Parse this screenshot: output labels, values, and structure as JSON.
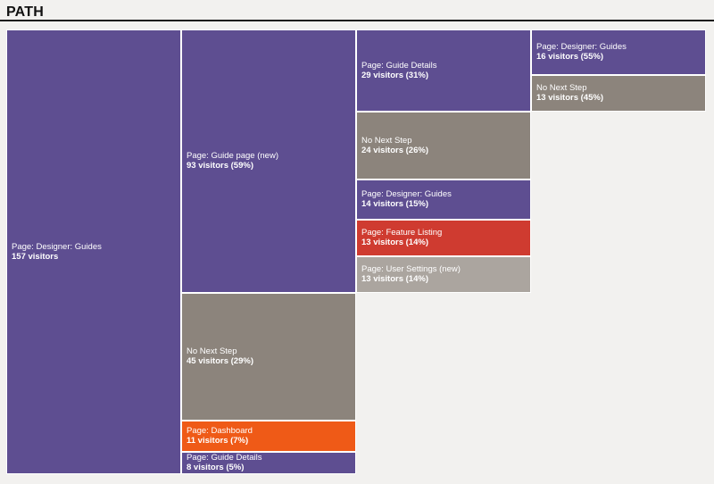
{
  "header": {
    "title": "PATH"
  },
  "colors": {
    "page": "#5e4e91",
    "no_next_step": "#8c847c",
    "dashboard": "#ef5a17",
    "feature_listing": "#cf3b30",
    "user_settings": "#aba59f",
    "border": "#ffffff",
    "background": "#f2f1ef"
  },
  "chart_data": {
    "type": "treemap",
    "title": "PATH",
    "root": {
      "label": "Page: Designer: Guides",
      "metric": "157 visitors",
      "visitors": 157,
      "color": "#5e4e91",
      "children": [
        {
          "label": "Page: Guide page (new)",
          "metric": "93 visitors  (59%)",
          "visitors": 93,
          "percent": 59,
          "color": "#5e4e91",
          "children": [
            {
              "label": "Page: Guide Details",
              "metric": "29 visitors  (31%)",
              "visitors": 29,
              "percent": 31,
              "color": "#5e4e91",
              "children": [
                {
                  "label": "Page: Designer: Guides",
                  "metric": "16 visitors  (55%)",
                  "visitors": 16,
                  "percent": 55,
                  "color": "#5e4e91",
                  "children": []
                },
                {
                  "label": "No Next Step",
                  "metric": "13 visitors  (45%)",
                  "visitors": 13,
                  "percent": 45,
                  "color": "#8c847c",
                  "children": []
                }
              ]
            },
            {
              "label": "No Next Step",
              "metric": "24 visitors  (26%)",
              "visitors": 24,
              "percent": 26,
              "color": "#8c847c",
              "children": []
            },
            {
              "label": "Page: Designer: Guides",
              "metric": "14 visitors  (15%)",
              "visitors": 14,
              "percent": 15,
              "color": "#5e4e91",
              "children": []
            },
            {
              "label": "Page: Feature Listing",
              "metric": "13 visitors  (14%)",
              "visitors": 13,
              "percent": 14,
              "color": "#cf3b30",
              "children": []
            },
            {
              "label": "Page: User Settings (new)",
              "metric": "13 visitors  (14%)",
              "visitors": 13,
              "percent": 14,
              "color": "#aba59f",
              "children": []
            }
          ]
        },
        {
          "label": "No Next Step",
          "metric": "45 visitors  (29%)",
          "visitors": 45,
          "percent": 29,
          "color": "#8c847c",
          "children": []
        },
        {
          "label": "Page: Dashboard",
          "metric": "11 visitors  (7%)",
          "visitors": 11,
          "percent": 7,
          "color": "#ef5a17",
          "children": []
        },
        {
          "label": "Page: Guide Details",
          "metric": "8 visitors  (5%)",
          "visitors": 8,
          "percent": 5,
          "color": "#5e4e91",
          "children": []
        }
      ]
    }
  }
}
